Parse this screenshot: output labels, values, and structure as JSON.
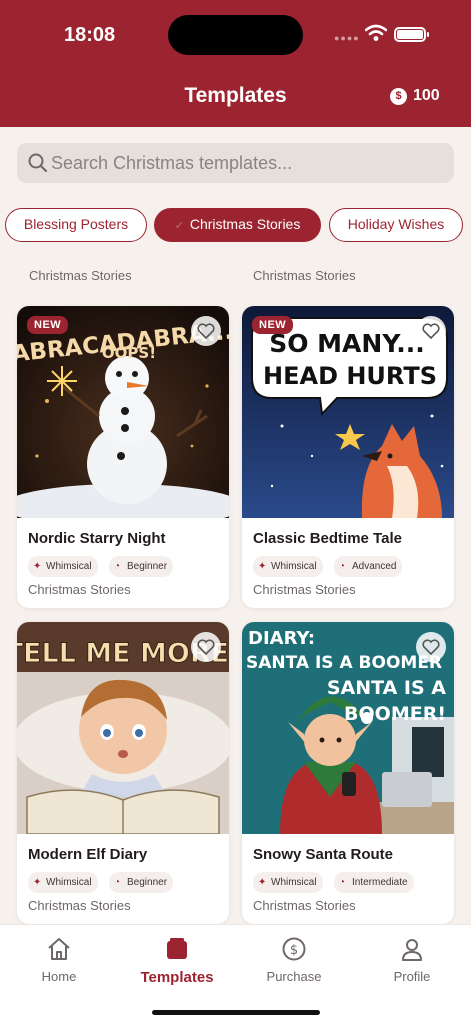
{
  "status_bar": {
    "time": "18:08"
  },
  "header": {
    "title": "Templates",
    "coin_symbol": "$",
    "coin_count": "100"
  },
  "search": {
    "placeholder": "Search Christmas templates..."
  },
  "chips": [
    {
      "label": "Blessing Posters",
      "active": false
    },
    {
      "label": "Christmas Stories",
      "active": true
    },
    {
      "label": "Holiday Wishes",
      "active": false
    }
  ],
  "partial_row": [
    "Christmas Stories",
    "Christmas Stories"
  ],
  "cards": [
    {
      "title": "Nordic Starry Night",
      "new": "NEW",
      "image_text": [
        "ABRACADABRA...",
        "OOPS!"
      ],
      "style": "Whimsical",
      "level": "Beginner",
      "category": "Christmas Stories"
    },
    {
      "title": "Classic Bedtime Tale",
      "new": "NEW",
      "image_text": [
        "SO MANY...",
        "HEAD HURTS"
      ],
      "style": "Whimsical",
      "level": "Advanced",
      "category": "Christmas Stories"
    },
    {
      "title": "Modern Elf Diary",
      "new": "",
      "image_text": [
        "TELL ME MORE!"
      ],
      "style": "Whimsical",
      "level": "Beginner",
      "category": "Christmas Stories"
    },
    {
      "title": "Snowy Santa Route",
      "new": "",
      "image_text": [
        "DIARY:",
        "SANTA IS A BOOMER",
        "SANTA IS A",
        "BOOMER!"
      ],
      "style": "Whimsical",
      "level": "Intermediate",
      "category": "Christmas Stories"
    }
  ],
  "tabbar": [
    {
      "label": "Home",
      "icon": "home-icon"
    },
    {
      "label": "Templates",
      "icon": "templates-icon",
      "active": true
    },
    {
      "label": "Purchase",
      "icon": "dollar-icon"
    },
    {
      "label": "Profile",
      "icon": "person-icon"
    }
  ],
  "colors": {
    "brand": "#9c2431",
    "background": "#f6f1ed"
  }
}
